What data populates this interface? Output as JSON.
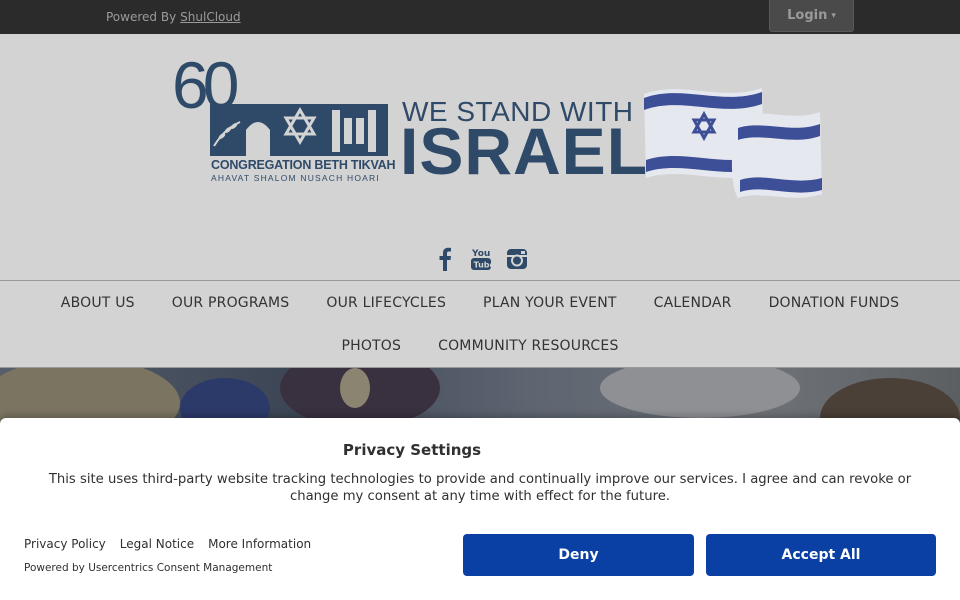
{
  "topbar": {
    "powered_by_label": "Powered By",
    "powered_by_link": "ShulCloud",
    "login_label": "Login",
    "login_caret": "▾"
  },
  "logo": {
    "anniversary": "60",
    "congregation_name": "CONGREGATION BETH TIKVAH",
    "tagline": "AHAVAT SHALOM NUSACH HOARI",
    "banner_line1": "WE STAND WITH",
    "banner_line2": "ISRAEL",
    "brand_color": "#2f4a68"
  },
  "socials": [
    {
      "name": "facebook-icon"
    },
    {
      "name": "youtube-icon"
    },
    {
      "name": "instagram-icon"
    }
  ],
  "nav": {
    "row1": [
      "ABOUT US",
      "OUR PROGRAMS",
      "OUR LIFECYCLES",
      "PLAN YOUR EVENT",
      "CALENDAR",
      "DONATION FUNDS"
    ],
    "row2": [
      "PHOTOS",
      "COMMUNITY RESOURCES"
    ]
  },
  "privacy": {
    "title": "Privacy Settings",
    "body": "This site uses third-party website tracking technologies to provide and continually improve our services. I agree and can revoke or change my consent at any time with effect for the future.",
    "links": [
      "Privacy Policy",
      "Legal Notice",
      "More Information"
    ],
    "credit": "Powered by Usercentrics Consent Management",
    "deny_label": "Deny",
    "accept_label": "Accept All",
    "button_color": "#0a3fa3"
  }
}
